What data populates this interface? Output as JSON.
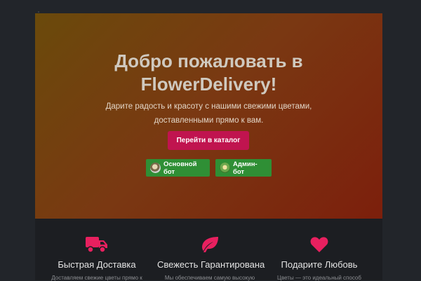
{
  "hero": {
    "title_line1": "Добро пожаловать в",
    "title_line2": "FlowerDelivery!",
    "subtitle_line1": "Дарите радость и красоту с нашими свежими цветами,",
    "subtitle_line2": "доставленными прямо к вам.",
    "cta_label": "Перейти в каталог",
    "bots": [
      {
        "label": "Основной бот",
        "icon": "bot-avatar-icon"
      },
      {
        "label": "Админ-бот",
        "icon": "admin-bot-avatar-icon"
      }
    ]
  },
  "features": [
    {
      "icon": "truck-icon",
      "title": "Быстрая Доставка",
      "desc": "Доставляем свежие цветы прямо к"
    },
    {
      "icon": "leaf-icon",
      "title": "Свежесть Гарантирована",
      "desc": "Мы обеспечиваем самую высокую"
    },
    {
      "icon": "heart-icon",
      "title": "Подарите Любовь",
      "desc": "Цветы — это идеальный способ"
    }
  ],
  "colors": {
    "accent": "#c0144f",
    "bot_button": "#2f8f35",
    "feature_icon": "#e8205f",
    "background": "#22252a"
  }
}
